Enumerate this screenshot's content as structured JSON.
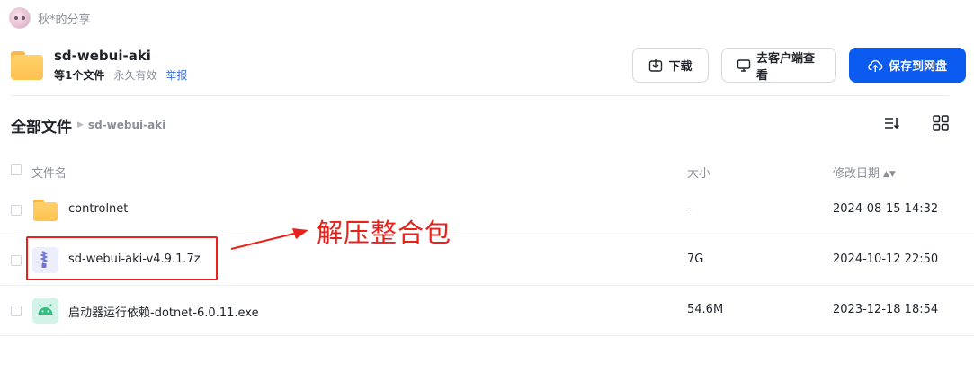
{
  "owner": {
    "name": "秋*的分享"
  },
  "share": {
    "title": "sd-webui-aki",
    "count": "等1个文件",
    "validity": "永久有效",
    "report": "举报"
  },
  "actions": {
    "download": "下载",
    "open_client": "去客户端查看",
    "save": "保存到网盘"
  },
  "breadcrumb": {
    "root": "全部文件",
    "current": "sd-webui-aki"
  },
  "table": {
    "headers": {
      "name": "文件名",
      "size": "大小",
      "date": "修改日期"
    },
    "rows": [
      {
        "name": "controlnet",
        "size": "-",
        "date": "2024-08-15 14:32",
        "icon": "folder-icon"
      },
      {
        "name": "sd-webui-aki-v4.9.1.7z",
        "size": "7G",
        "date": "2024-10-12 22:50",
        "icon": "zip-icon"
      },
      {
        "name": "启动器运行依赖-dotnet-6.0.11.exe",
        "size": "54.6M",
        "date": "2023-12-18 18:54",
        "icon": "android-exe-icon"
      }
    ]
  },
  "annotation": {
    "text": "解压整合包",
    "color": "#e8221b"
  },
  "colors": {
    "accent": "#0b5bf0",
    "folder": "#fdc250",
    "annotation": "#e8221b"
  }
}
